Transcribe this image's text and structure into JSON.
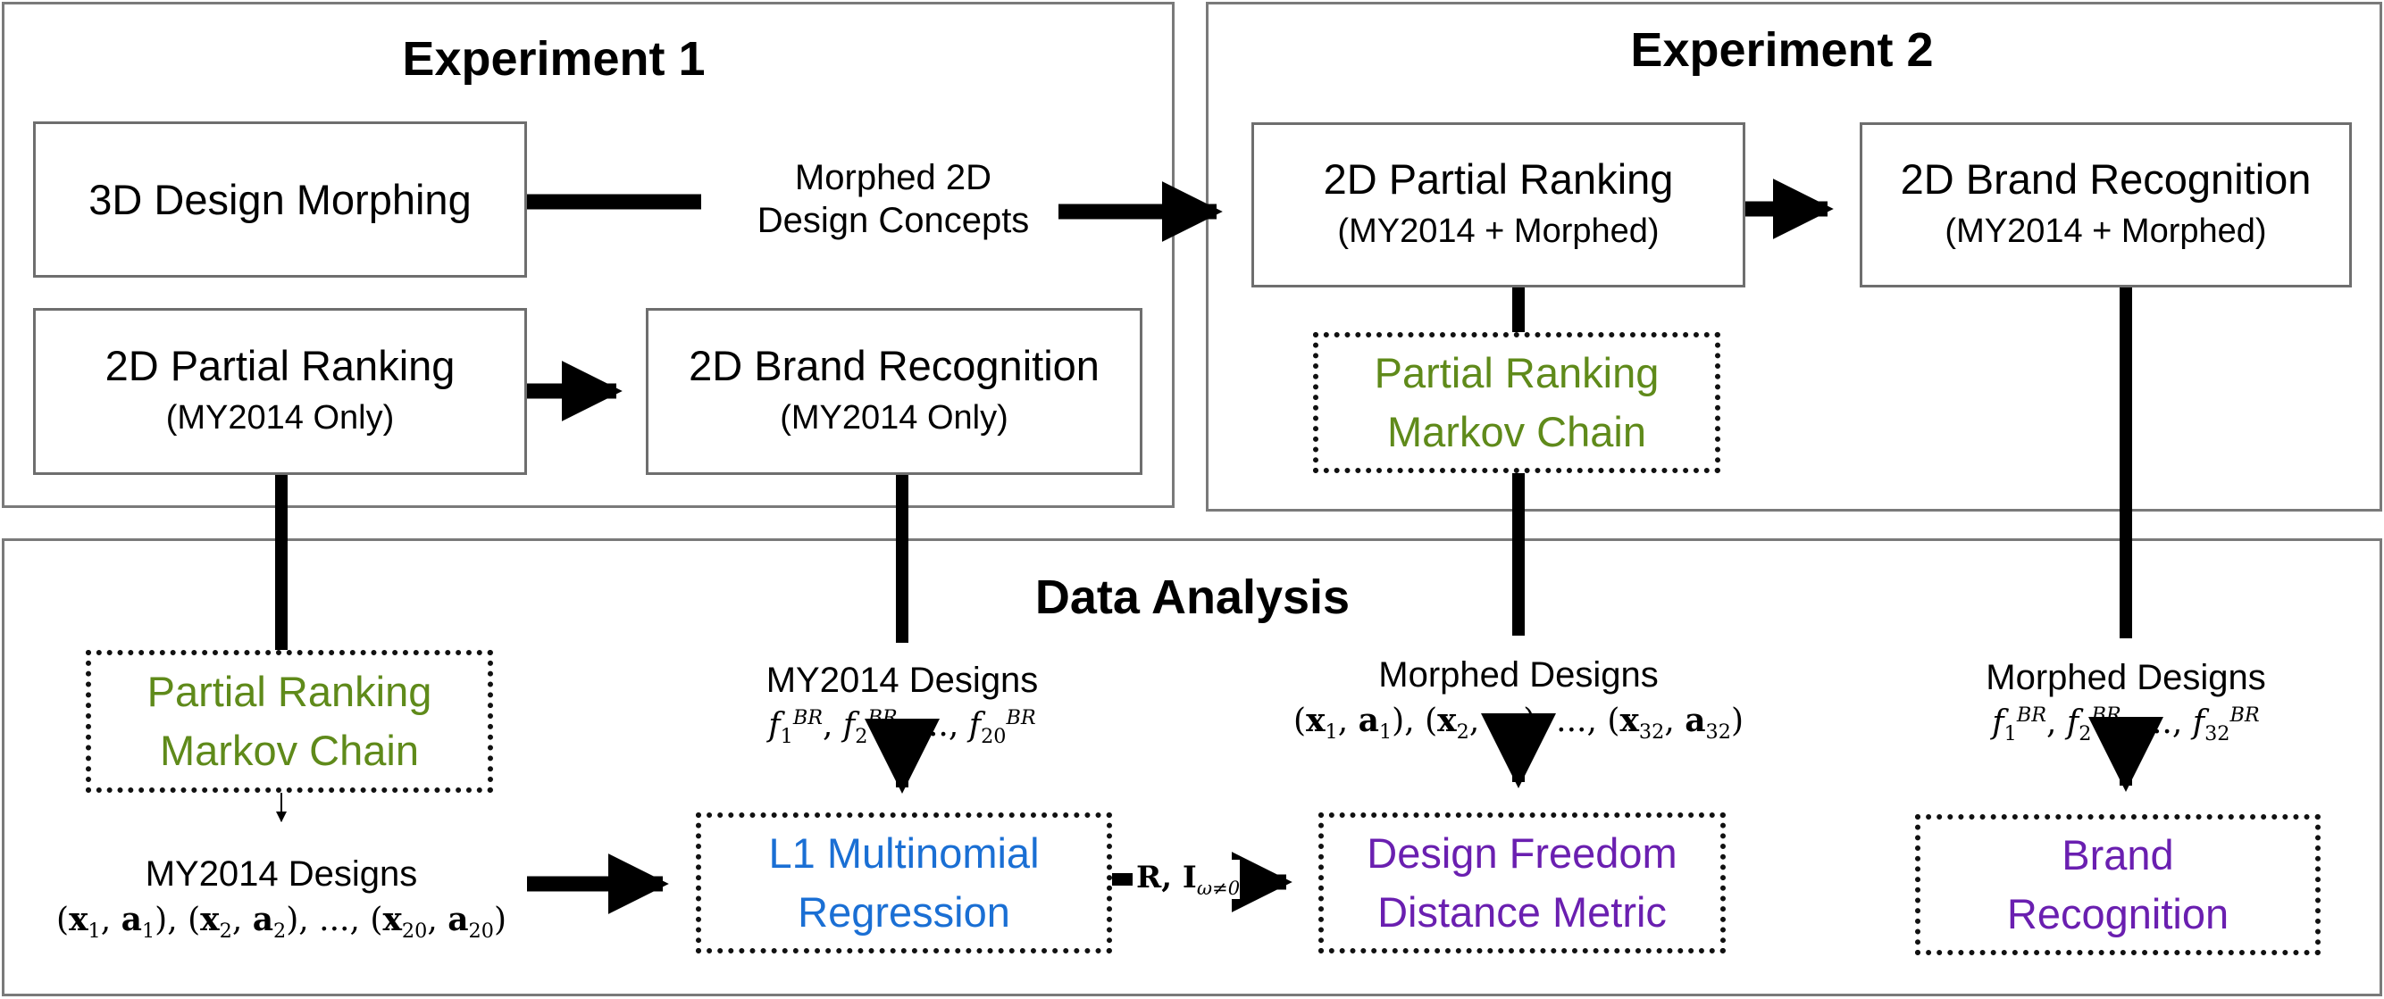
{
  "panels": {
    "experiment1": {
      "title": "Experiment 1"
    },
    "experiment2": {
      "title": "Experiment 2"
    },
    "data_analysis": {
      "title": "Data Analysis"
    }
  },
  "experiment1": {
    "design_morphing": {
      "label": "3D Design Morphing"
    },
    "morphed_concepts": {
      "line1": "Morphed 2D",
      "line2": "Design Concepts"
    },
    "partial_ranking": {
      "label": "2D Partial Ranking",
      "sub": "(MY2014  Only)"
    },
    "brand_recognition": {
      "label": "2D Brand Recognition",
      "sub": "(MY2014  Only)"
    }
  },
  "experiment2": {
    "partial_ranking": {
      "label": "2D Partial Ranking",
      "sub": "(MY2014 + Morphed)"
    },
    "brand_recognition": {
      "label": "2D Brand Recognition",
      "sub": "(MY2014 + Morphed)"
    },
    "markov_chain": {
      "line1": "Partial Ranking",
      "line2": "Markov Chain"
    }
  },
  "data_analysis": {
    "markov_chain": {
      "line1": "Partial Ranking",
      "line2": "Markov Chain"
    },
    "my2014_designs_pairs": {
      "title": "MY2014 Designs",
      "formula": "(x₁, a₁), (x₂, a₂), ..., (x₂₀, a₂₀)",
      "last_index": "20"
    },
    "my2014_designs_f": {
      "title": "MY2014 Designs",
      "formula": "f₁ᴮᴿ, f₂ᴮᴿ, ..., f₂₀ᴮᴿ",
      "last_index": "20",
      "superscript": "BR"
    },
    "morphed_designs_pairs": {
      "title": "Morphed Designs",
      "formula": "(x₁, a₁), (x₂, a₂), ..., (x₃₂, a₃₂)",
      "last_index": "32"
    },
    "morphed_designs_f": {
      "title": "Morphed Designs",
      "formula": "f₁ᴮᴿ, f₂ᴮᴿ, ..., f₃₂ᴮᴿ",
      "last_index": "32",
      "superscript": "BR"
    },
    "l1_regression": {
      "line1": "L1 Multinomial",
      "line2": "Regression"
    },
    "edge_label": {
      "main": "R, I",
      "subscript": "ω≠0"
    },
    "design_freedom": {
      "line1": "Design Freedom",
      "line2": "Distance Metric"
    },
    "brand_recognition": {
      "line1": "Brand",
      "line2": "Recognition"
    }
  },
  "colors": {
    "markov_text": "#5f8a1a",
    "regression_text": "#1a6fd4",
    "metric_text": "#6a1fb0",
    "connector": "#000000"
  }
}
